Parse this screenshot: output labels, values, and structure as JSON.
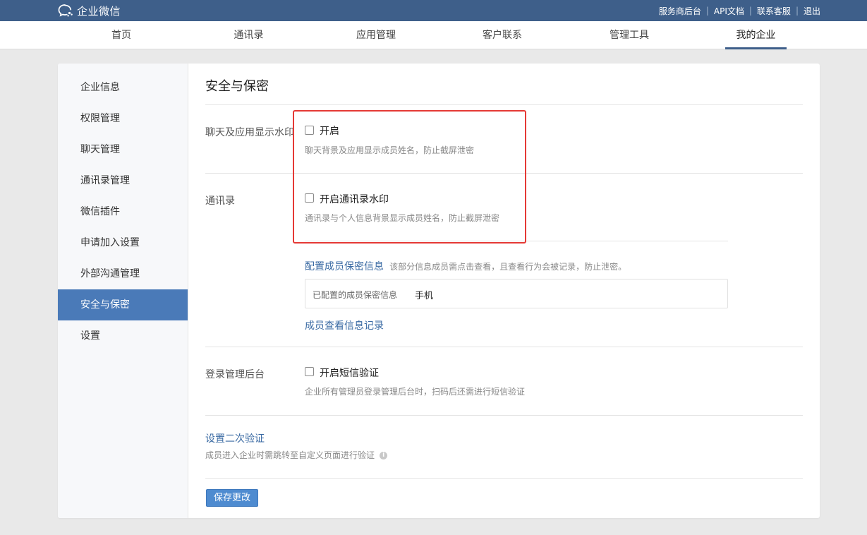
{
  "header": {
    "brand": "企业微信",
    "links": [
      "服务商后台",
      "API文档",
      "联系客服",
      "退出"
    ]
  },
  "nav": {
    "tabs": [
      "首页",
      "通讯录",
      "应用管理",
      "客户联系",
      "管理工具",
      "我的企业"
    ],
    "active": "我的企业"
  },
  "sidebar": {
    "items": [
      "企业信息",
      "权限管理",
      "聊天管理",
      "通讯录管理",
      "微信插件",
      "申请加入设置",
      "外部沟通管理",
      "安全与保密",
      "设置"
    ],
    "active": "安全与保密"
  },
  "main": {
    "title": "安全与保密",
    "watermark": {
      "label": "聊天及应用显示水印",
      "checkbox_label": "开启",
      "checked": false,
      "hint": "聊天背景及应用显示成员姓名，防止截屏泄密"
    },
    "contacts": {
      "label": "通讯录",
      "checkbox_label": "开启通讯录水印",
      "checked": false,
      "hint": "通讯录与个人信息背景显示成员姓名，防止截屏泄密",
      "config_link": "配置成员保密信息",
      "config_desc": "该部分信息成员需点击查看，且查看行为会被记录，防止泄密。",
      "configured_key": "已配置的成员保密信息",
      "configured_value": "手机",
      "records_link": "成员查看信息记录"
    },
    "login": {
      "label": "登录管理后台",
      "checkbox_label": "开启短信验证",
      "checked": false,
      "hint": "企业所有管理员登录管理后台时，扫码后还需进行短信验证"
    },
    "second_verify": {
      "link": "设置二次验证",
      "hint": "成员进入企业时需跳转至自定义页面进行验证"
    },
    "save_label": "保存更改"
  },
  "colors": {
    "header_bg": "#3e5f8a",
    "sidebar_active": "#4a7ab8",
    "link": "#3a6aa3",
    "button": "#4e8bd0",
    "highlight": "#e53935"
  }
}
